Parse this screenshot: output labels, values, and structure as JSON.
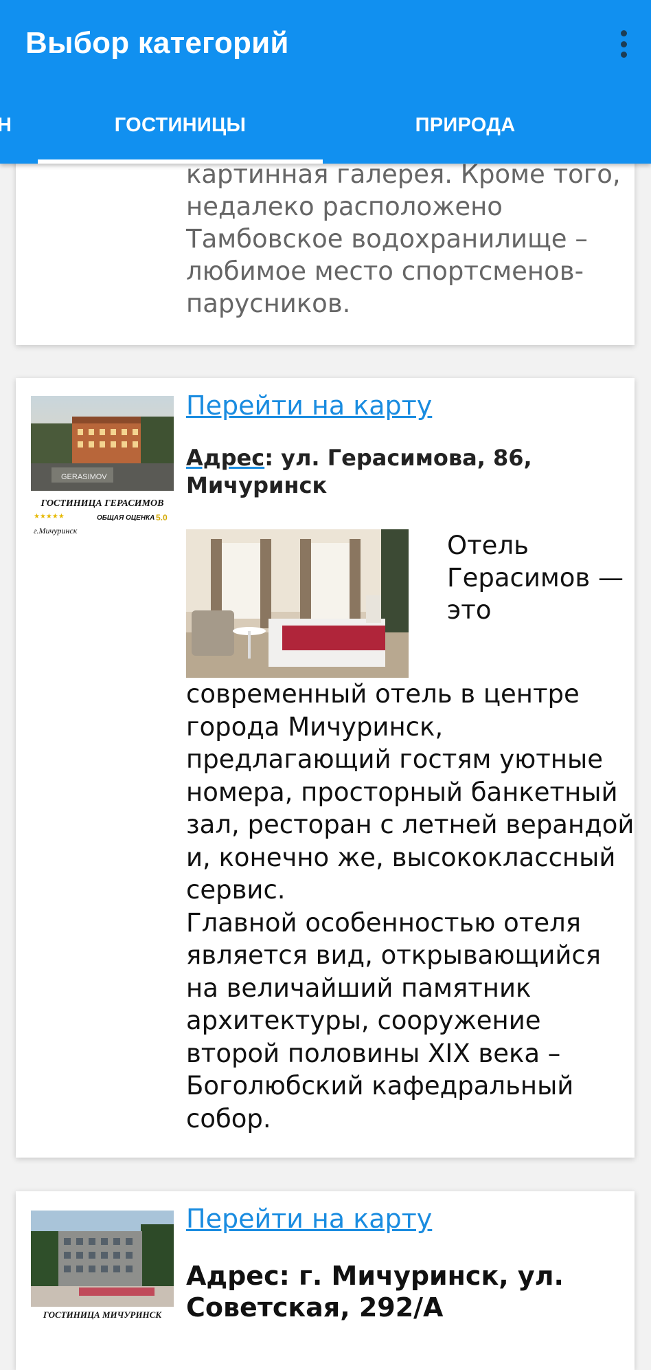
{
  "appbar": {
    "title": "Выбор категорий",
    "menu_icon": "more-vert-icon"
  },
  "tabs": [
    {
      "label": "Н"
    },
    {
      "label": "ГОСТИНИЦЫ",
      "selected": true
    },
    {
      "label": "ПРИРОДА"
    }
  ],
  "cards": [
    {
      "description": "картинная галерея. Кроме того, недалеко расположено Тамбовское водохранилище – любимое место спортсменов-парусников."
    },
    {
      "thumb": {
        "title": "ГОСТИНИЦА ГЕРАСИМОВ",
        "sign": "GERASIMOV",
        "rating_label": "ОБЩАЯ ОЦЕНКА",
        "rating": "5.0",
        "stars": "★★★★★",
        "city": "г.Мичуринск"
      },
      "map_link": "Перейти на карту",
      "address_label": "Адрес",
      "address_value": ": ул. Герасимова, 86, Мичуринск",
      "float_text": " Отель Герасимов — это",
      "body_text": "современный отель в центре города Мичуринск, предлагающий гостям уютные номера, просторный банкетный зал, ресторан с летней верандой и, конечно же, высококлассный сервис.",
      "body_text2": "Главной особенностью отеля является вид, открывающийся на величайший памятник архитектуры, сооружение второй половины XIX века – Боголюбский кафедральный собор."
    },
    {
      "thumb": {
        "title": "ГОСТИНИЦА МИЧУРИНСК"
      },
      "map_link": "Перейти на карту",
      "address": "Адрес: г. Мичуринск, ул. Советская, 292/А"
    }
  ],
  "colors": {
    "accent": "#1190f0",
    "link": "#1a8ce0"
  }
}
